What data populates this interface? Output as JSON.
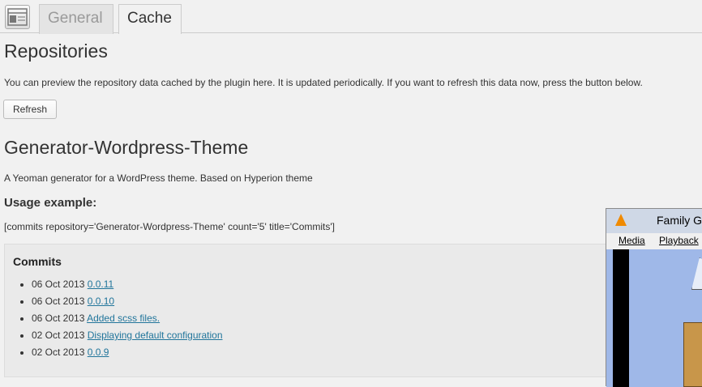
{
  "tabs": [
    {
      "label": "General",
      "active": false
    },
    {
      "label": "Cache",
      "active": true
    }
  ],
  "repositories": {
    "title": "Repositories",
    "description": "You can preview the repository data cached by the plugin here. It is updated periodically. If you want to refresh this data now, press the button below.",
    "refresh_label": "Refresh"
  },
  "repo": {
    "name": "Generator-Wordpress-Theme",
    "description": "A Yeoman generator for a WordPress theme. Based on Hyperion theme",
    "usage_title": "Usage example:",
    "usage_code": "[commits repository='Generator-Wordpress-Theme' count='5' title='Commits']"
  },
  "commits": {
    "title": "Commits",
    "items": [
      {
        "date": "06 Oct 2013",
        "message": "0.0.11"
      },
      {
        "date": "06 Oct 2013",
        "message": "0.0.10"
      },
      {
        "date": "06 Oct 2013",
        "message": "Added scss files."
      },
      {
        "date": "02 Oct 2013",
        "message": "Displaying default configuration"
      },
      {
        "date": "02 Oct 2013",
        "message": "0.0.9"
      }
    ]
  },
  "vlc": {
    "title": "Family G",
    "menu": [
      "Media",
      "Playback"
    ]
  },
  "colors": {
    "link": "#21759b",
    "page_bg": "#f1f1f1",
    "commits_bg": "#eaeaea",
    "vlc_accent": "#f08a00"
  }
}
